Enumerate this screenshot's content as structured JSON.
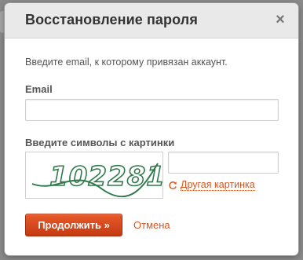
{
  "dialog": {
    "title": "Восстановление пароля",
    "close_label": "×"
  },
  "form": {
    "hint": "Введите email, к которому привязан аккаунт.",
    "email_label": "Email",
    "email_value": "",
    "captcha_label": "Введите символы с картинки",
    "captcha_image_text": "102281",
    "captcha_value": "",
    "refresh_label": "Другая картинка",
    "submit_label": "Продолжить »",
    "cancel_label": "Отмена"
  },
  "colors": {
    "accent": "#d9541e",
    "button_top": "#e75a2a",
    "button_bottom": "#c43a12",
    "captcha_ink": "#2f7a4a"
  },
  "icons": {
    "close": "close-icon",
    "refresh": "refresh-icon"
  }
}
